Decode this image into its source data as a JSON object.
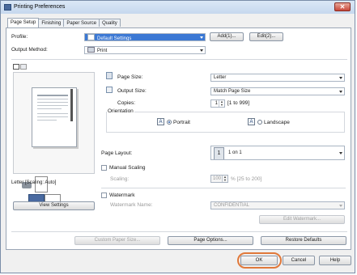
{
  "window": {
    "title": "Printing Preferences",
    "close_glyph": "✕"
  },
  "tabs": [
    {
      "label": "Page Setup",
      "active": true
    },
    {
      "label": "Finishing",
      "active": false
    },
    {
      "label": "Paper Source",
      "active": false
    },
    {
      "label": "Quality",
      "active": false
    }
  ],
  "profile": {
    "label": "Profile:",
    "value": "Default Settings",
    "add_button": "Add(1)...",
    "edit_button": "Edit(2)..."
  },
  "output_method": {
    "label": "Output Method:",
    "value": "Print"
  },
  "preview": {
    "caption": "Letter [Scaling: Auto]",
    "view_settings_button": "View Settings"
  },
  "page_size": {
    "label": "Page Size:",
    "value": "Letter"
  },
  "output_size": {
    "label": "Output Size:",
    "value": "Match Page Size"
  },
  "copies": {
    "label": "Copies:",
    "value": "1",
    "range": "[1 to 999]"
  },
  "orientation": {
    "label": "Orientation",
    "portrait": "Portrait",
    "landscape": "Landscape",
    "selected": "Portrait"
  },
  "page_layout": {
    "label": "Page Layout:",
    "value": "1 on 1",
    "badge": "1"
  },
  "manual_scaling": {
    "label": "Manual Scaling",
    "checked": false,
    "scaling_label": "Scaling:",
    "value": "100",
    "range": "% [25 to 200]"
  },
  "watermark": {
    "label": "Watermark",
    "checked": false,
    "name_label": "Watermark Name:",
    "value": "CONFIDENTIAL",
    "edit_button": "Edit Watermark..."
  },
  "bottom_buttons": {
    "custom_paper_size": "Custom Paper Size...",
    "page_options": "Page Options...",
    "restore_defaults": "Restore Defaults"
  },
  "dialog_buttons": {
    "ok": "OK",
    "cancel": "Cancel",
    "help": "Help"
  },
  "colors": {
    "highlight_ring": "#e0783a",
    "selection_blue": "#3b78d4"
  }
}
